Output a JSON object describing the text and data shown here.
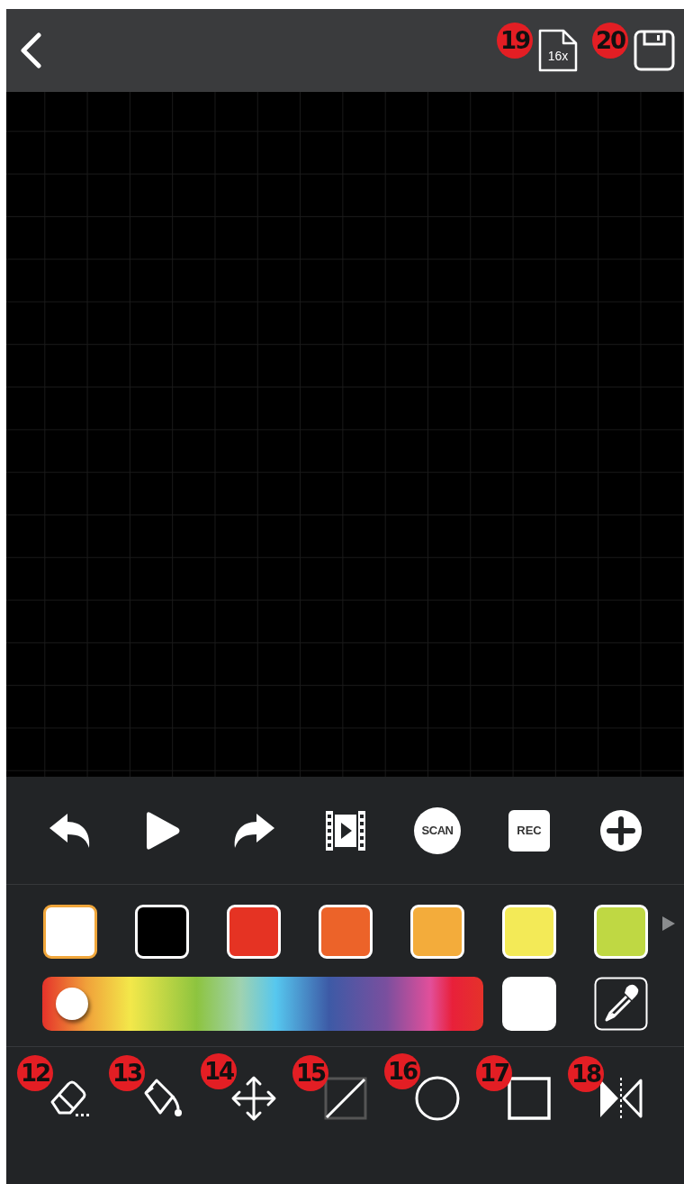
{
  "header": {
    "actions": [
      {
        "kind": "file",
        "label": "16x",
        "badge": "19"
      },
      {
        "kind": "save",
        "badge": "20"
      }
    ]
  },
  "playback": [
    {
      "kind": "undo"
    },
    {
      "kind": "play"
    },
    {
      "kind": "redo"
    },
    {
      "kind": "film"
    },
    {
      "kind": "scan",
      "label": "SCAN"
    },
    {
      "kind": "rec",
      "label": "REC"
    },
    {
      "kind": "add"
    }
  ],
  "palette": [
    {
      "color": "#ffffff",
      "selected": true
    },
    {
      "color": "#000000",
      "selected": false
    },
    {
      "color": "#e53323",
      "selected": false
    },
    {
      "color": "#ec6329",
      "selected": false
    },
    {
      "color": "#f3ac3b",
      "selected": false
    },
    {
      "color": "#f3ea57",
      "selected": false
    },
    {
      "color": "#bfd843",
      "selected": false
    }
  ],
  "hue": {
    "level": 0.02
  },
  "current": {
    "color": "#ffffff"
  },
  "tools": [
    {
      "kind": "eraser",
      "badge": "12"
    },
    {
      "kind": "fill",
      "badge": "13"
    },
    {
      "kind": "move",
      "badge": "14"
    },
    {
      "kind": "line",
      "badge": "15"
    },
    {
      "kind": "circle",
      "badge": "16"
    },
    {
      "kind": "square",
      "badge": "17"
    },
    {
      "kind": "mirror",
      "badge": "18"
    }
  ]
}
